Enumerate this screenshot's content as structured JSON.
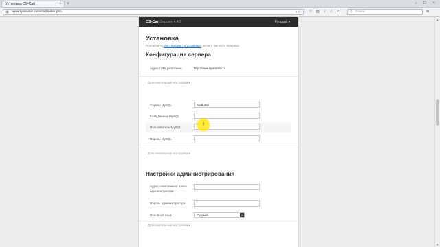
{
  "browser": {
    "tab_title": "Установка CS-Cart",
    "url": "www.ilyakamin.ru/install/index.php",
    "search_placeholder": "Поиск"
  },
  "topbar": {
    "brand": "CS-Cart",
    "version": "Версия: 4.4.3",
    "language": "Русский ▾"
  },
  "page": {
    "title": "Установка",
    "note_prefix": "Прочитайте",
    "note_link": "Инструкцию по установке",
    "note_suffix": ", если у вас есть вопросы"
  },
  "server": {
    "heading": "Конфигурация сервера",
    "store_url_label": "Адрес (URL) магазина",
    "store_url_value": "http://www.ilyakamin.ru",
    "more_settings_1": "Дополнительные настройки ▾",
    "mysql_server_label": "Сервер MySQL",
    "mysql_server_value": "localhost",
    "mysql_db_label": "База данных MySQL",
    "mysql_db_value": "",
    "mysql_user_label": "Пользователь MySQL",
    "mysql_user_value": "",
    "mysql_password_label": "Пароль MySQL",
    "mysql_password_value": "",
    "more_settings_2": "Дополнительные настройки ▾"
  },
  "admin": {
    "heading": "Настройки администрирования",
    "email_label_line1": "Адрес электронной почты",
    "email_label_line2": "администратора",
    "email_value": "",
    "password_label": "Пароль администратора",
    "password_value": "",
    "language_label": "Основной язык",
    "language_value": "Русский",
    "more_settings": "Дополнительные настройки ▾"
  }
}
